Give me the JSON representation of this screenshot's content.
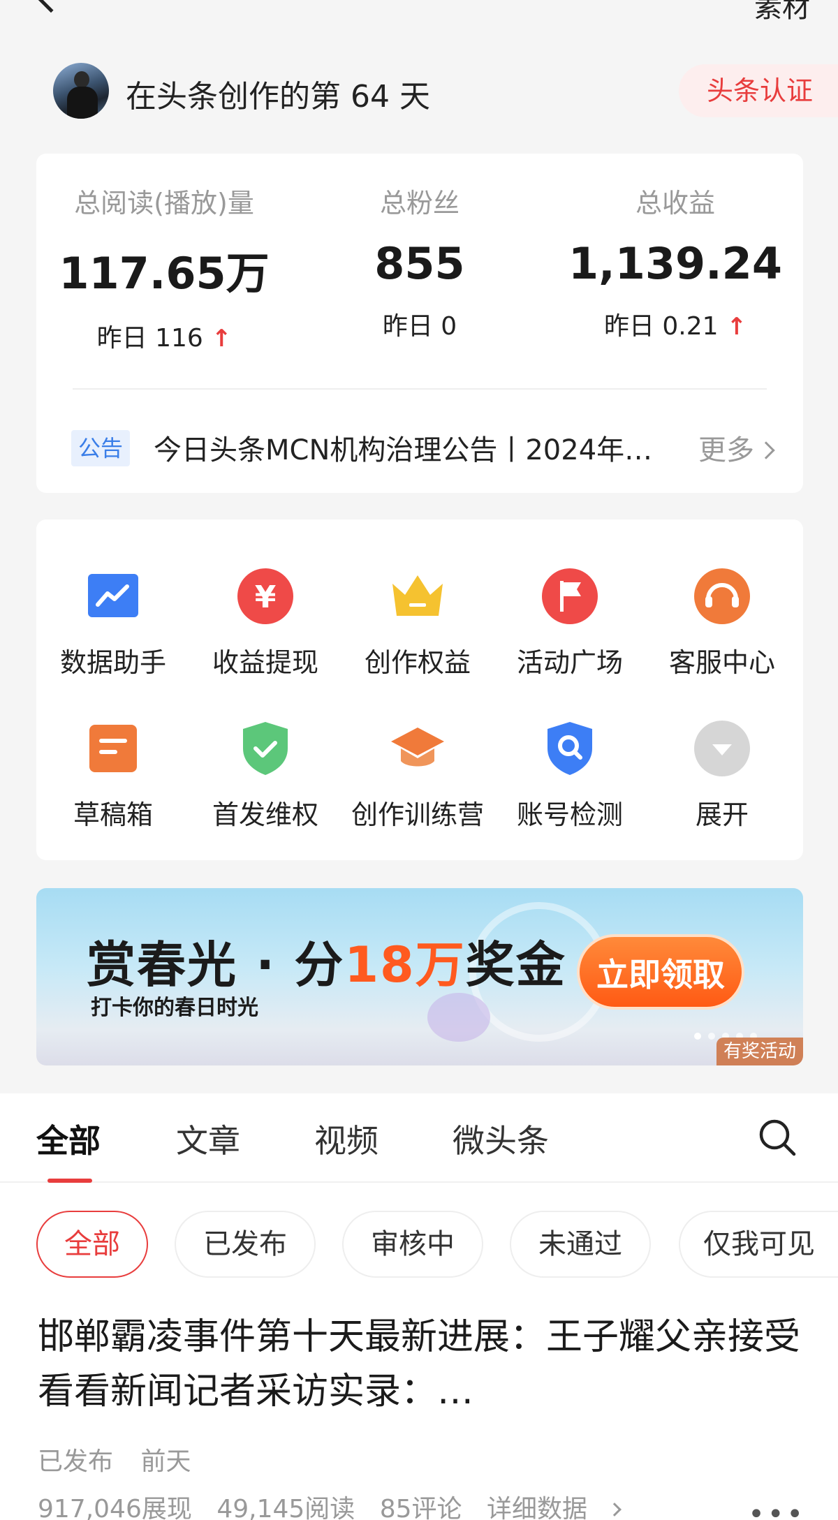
{
  "topbar": {
    "right_label_partial": "素材"
  },
  "profile": {
    "days_label": "在头条创作的第 64 天",
    "certification": "头条认证"
  },
  "stats": [
    {
      "label": "总阅读(播放)量",
      "value": "117.65万",
      "yesterday": "昨日 116",
      "trend": "up"
    },
    {
      "label": "总粉丝",
      "value": "855",
      "yesterday": "昨日 0",
      "trend": "none"
    },
    {
      "label": "总收益",
      "value": "1,139.24",
      "yesterday": "昨日 0.21",
      "trend": "up"
    }
  ],
  "notice": {
    "tag": "公告",
    "text": "今日头条MCN机构治理公告丨2024年…",
    "more": "更多"
  },
  "tools": [
    {
      "label": "数据助手",
      "icon": "chart-trend-icon",
      "color": "#3d7ef5"
    },
    {
      "label": "收益提现",
      "icon": "yen-coin-icon",
      "color": "#ef4a48"
    },
    {
      "label": "创作权益",
      "icon": "crown-icon",
      "color": "#f5c230"
    },
    {
      "label": "活动广场",
      "icon": "flag-icon",
      "color": "#ef4a48"
    },
    {
      "label": "客服中心",
      "icon": "headset-icon",
      "color": "#f07a3a"
    },
    {
      "label": "草稿箱",
      "icon": "draft-box-icon",
      "color": "#f07a3a"
    },
    {
      "label": "首发维权",
      "icon": "shield-check-icon",
      "color": "#5cc77a"
    },
    {
      "label": "创作训练营",
      "icon": "graduation-cap-icon",
      "color": "#f07a3a"
    },
    {
      "label": "账号检测",
      "icon": "shield-search-icon",
      "color": "#3d7ef5"
    },
    {
      "label": "展开",
      "icon": "expand-down-icon",
      "color": "#d6d6d6"
    }
  ],
  "banner": {
    "title_prefix": "赏春光 · 分",
    "title_highlight": "18万",
    "title_suffix": "奖金",
    "subtitle": "打卡你的春日时光",
    "cta": "立即领取",
    "badge": "有奖活动"
  },
  "content_tabs": [
    "全部",
    "文章",
    "视频",
    "微头条"
  ],
  "filter_chips": [
    "全部",
    "已发布",
    "审核中",
    "未通过",
    "仅我可见"
  ],
  "article": {
    "title": "邯郸霸凌事件第十天最新进展：王子耀父亲接受看看新闻记者采访实录：…",
    "status": "已发布",
    "time": "前天",
    "impressions": "917,046展现",
    "reads": "49,145阅读",
    "comments": "85评论",
    "detail_link": "详细数据"
  }
}
